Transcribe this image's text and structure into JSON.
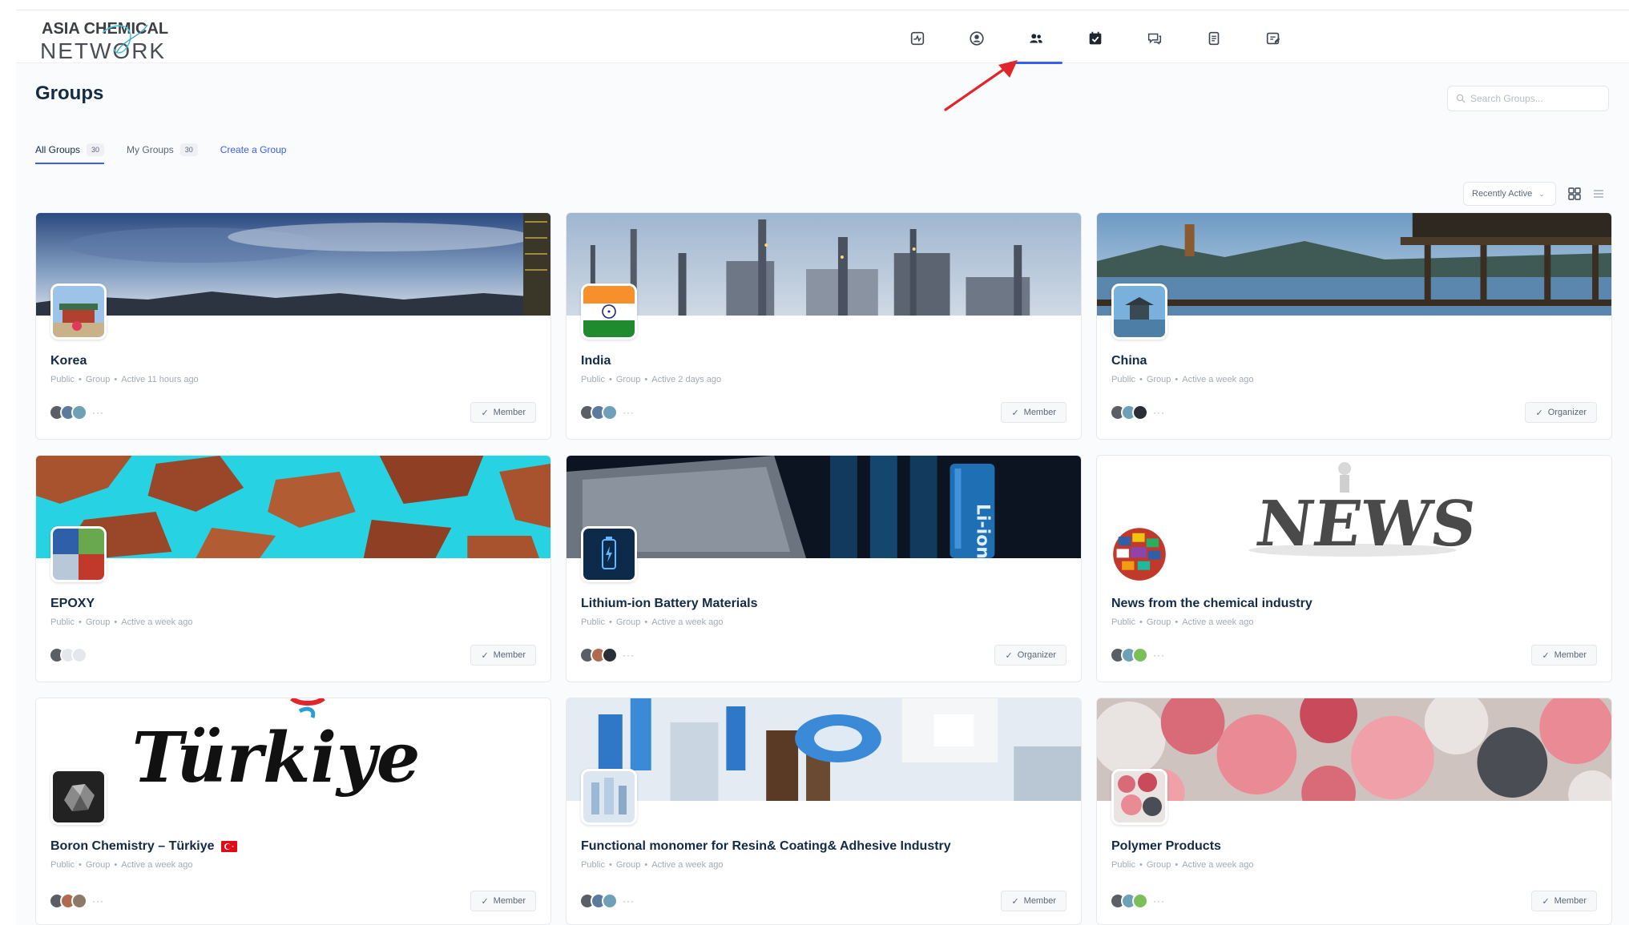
{
  "logo": {
    "line1": "ASIA CHEMICAL",
    "line2": "NETWORK"
  },
  "nav": [
    {
      "name": "activity-icon",
      "active": false
    },
    {
      "name": "profile-icon",
      "active": false
    },
    {
      "name": "groups-icon",
      "active": true
    },
    {
      "name": "events-icon",
      "active": false
    },
    {
      "name": "messages-icon",
      "active": false
    },
    {
      "name": "documents-icon",
      "active": false
    },
    {
      "name": "forums-icon",
      "active": false
    }
  ],
  "page": {
    "title": "Groups"
  },
  "search": {
    "placeholder": "Search Groups..."
  },
  "tabs": {
    "all_label": "All Groups",
    "all_count": "30",
    "my_label": "My Groups",
    "my_count": "30",
    "create_label": "Create a Group"
  },
  "sort": {
    "label": "Recently Active"
  },
  "colors": {
    "accent": "#385dff",
    "heading": "#122b46",
    "arrow": "#e0262b"
  },
  "groups": [
    {
      "name": "Korea",
      "privacy": "Public",
      "type": "Group",
      "activity": "Active 11 hours ago",
      "role": "Member"
    },
    {
      "name": "India",
      "privacy": "Public",
      "type": "Group",
      "activity": "Active 2 days ago",
      "role": "Member"
    },
    {
      "name": "China",
      "privacy": "Public",
      "type": "Group",
      "activity": "Active a week ago",
      "role": "Organizer"
    },
    {
      "name": "EPOXY",
      "privacy": "Public",
      "type": "Group",
      "activity": "Active a week ago",
      "role": "Member"
    },
    {
      "name": "Lithium-ion Battery Materials",
      "privacy": "Public",
      "type": "Group",
      "activity": "Active a week ago",
      "role": "Organizer",
      "cover_text": "Li-ion"
    },
    {
      "name": "News from the chemical industry",
      "privacy": "Public",
      "type": "Group",
      "activity": "Active a week ago",
      "role": "Member",
      "cover_text": "NEWS"
    },
    {
      "name": "Boron Chemistry – Türkiye",
      "privacy": "Public",
      "type": "Group",
      "activity": "Active a week ago",
      "role": "Member",
      "cover_text": "Türkiye"
    },
    {
      "name": "Functional monomer for Resin& Coating& Adhesive Industry",
      "privacy": "Public",
      "type": "Group",
      "activity": "Active a week ago",
      "role": "Member"
    },
    {
      "name": "Polymer Products",
      "privacy": "Public",
      "type": "Group",
      "activity": "Active a week ago",
      "role": "Member"
    }
  ]
}
